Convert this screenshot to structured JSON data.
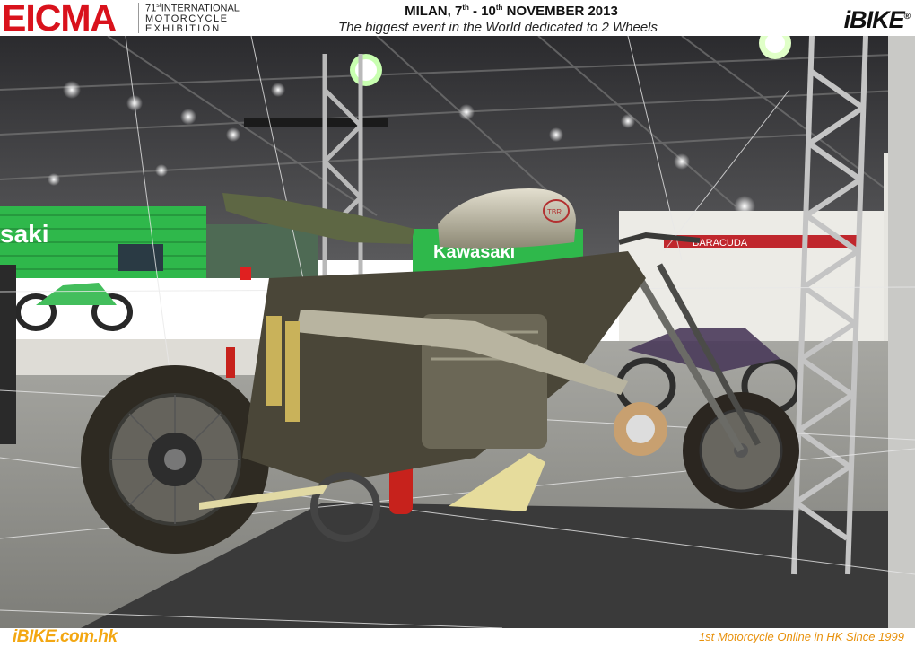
{
  "header": {
    "brand": "EICMA",
    "sub_line1_num": "71",
    "sub_line1_sup": "st",
    "sub_line1_text": "INTERNATIONAL",
    "sub_line2": "MOTORCYCLE",
    "sub_line3": "EXHIBITION",
    "date_prefix": "MILAN, 7",
    "date_sup1": "th",
    "date_mid": " - 10",
    "date_sup2": "th",
    "date_suffix": " NOVEMBER 2013",
    "tagline": "The biggest event in the World dedicated to 2 Wheels",
    "logo": "iBIKE",
    "logo_mark": "®"
  },
  "photo": {
    "booth_sign": "Kawasaki",
    "tank_badge": "TBR",
    "booth_banner": "BARACUDA",
    "colors": {
      "brand_red": "#d9121c",
      "kawasaki_green": "#2fb84b",
      "floor": "#8f8f8a",
      "carpet": "#3a3a3a"
    }
  },
  "footer": {
    "site": "iBIKE.com.hk",
    "slogan": "1st  Motorcycle Online in HK Since 1999"
  }
}
